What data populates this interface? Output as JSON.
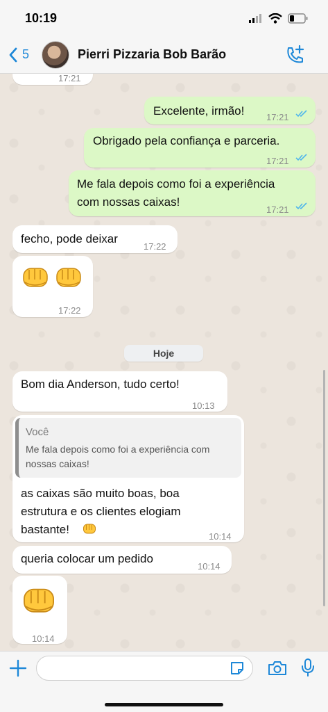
{
  "status_bar": {
    "time": "10:19"
  },
  "header": {
    "back_count": "5",
    "contact_name": "Pierri Pizzaria Bob Barão"
  },
  "messages": [
    {
      "dir": "in",
      "time": "17:21"
    },
    {
      "dir": "out",
      "text": "Excelente, irmão!",
      "time": "17:21",
      "read": true
    },
    {
      "dir": "out",
      "text": "Obrigado pela confiança e parceria.",
      "time": "17:21",
      "read": true
    },
    {
      "dir": "out",
      "text": "Me fala depois como foi a experiência com nossas caixas!",
      "line1": "Me fala depois como foi a experiência",
      "line2": "com nossas caixas!",
      "time": "17:21",
      "read": true
    },
    {
      "dir": "in",
      "text": "fecho, pode deixar",
      "time": "17:22"
    },
    {
      "dir": "in",
      "emoji": "fist-bump x2",
      "time": "17:22"
    },
    {
      "dir": "in",
      "text": "Bom dia Anderson, tudo certo!",
      "time": "10:13"
    },
    {
      "dir": "in",
      "quote_author": "Você",
      "quote_line1": "Me fala depois como foi a experiência com",
      "quote_line2": "nossas caixas!",
      "line1": "as caixas são muito boas, boa",
      "line2": "estrutura e os clientes elogiam",
      "line3": "bastante!",
      "time": "10:14"
    },
    {
      "dir": "in",
      "text": "queria colocar um pedido",
      "time": "10:14"
    },
    {
      "dir": "in",
      "emoji": "fist-bump",
      "time": "10:14"
    }
  ],
  "date_separator": "Hoje",
  "composer": {
    "placeholder": ""
  },
  "colors": {
    "accent": "#1e88d8",
    "outgoing": "#dcf8c6",
    "incoming": "#ffffff",
    "read_ticks": "#4fb6ec"
  },
  "icons": [
    "back-chevron-icon",
    "add-call-icon",
    "plus-icon",
    "sticker-icon",
    "camera-icon",
    "microphone-icon",
    "signal-icon",
    "wifi-icon",
    "battery-icon"
  ]
}
